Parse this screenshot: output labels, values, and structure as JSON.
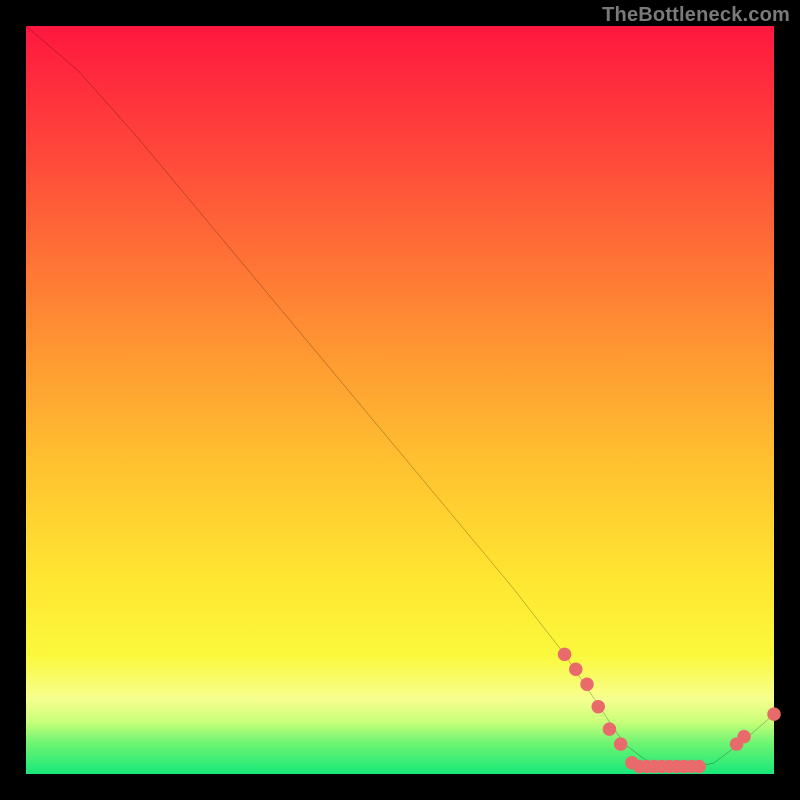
{
  "watermark": "TheBottleneck.com",
  "colors": {
    "frame": "#000000",
    "line": "#000000",
    "marker": "#e96a6a",
    "gradient_top": "#ff173f",
    "gradient_bottom": "#18e879"
  },
  "chart_data": {
    "type": "line",
    "title": "",
    "xlabel": "",
    "ylabel": "",
    "xlim": [
      0,
      100
    ],
    "ylim": [
      0,
      100
    ],
    "x": [
      0,
      7,
      15,
      25,
      35,
      45,
      55,
      65,
      72,
      76,
      80,
      84,
      88,
      92,
      96,
      100
    ],
    "y": [
      100,
      94,
      85,
      73,
      61,
      49,
      37,
      25,
      16,
      10,
      4,
      1,
      0.5,
      1.5,
      4.5,
      8
    ],
    "series": [
      {
        "name": "bottleneck-curve",
        "x": [
          0,
          7,
          15,
          25,
          35,
          45,
          55,
          65,
          72,
          76,
          80,
          84,
          88,
          92,
          96,
          100
        ],
        "y": [
          100,
          94,
          85,
          73,
          61,
          49,
          37,
          25,
          16,
          10,
          4,
          1,
          0.5,
          1.5,
          4.5,
          8
        ]
      }
    ],
    "markers": [
      {
        "x": 72,
        "y": 16
      },
      {
        "x": 73.5,
        "y": 14
      },
      {
        "x": 75,
        "y": 12
      },
      {
        "x": 76.5,
        "y": 9
      },
      {
        "x": 78,
        "y": 6
      },
      {
        "x": 79.5,
        "y": 4
      },
      {
        "x": 81,
        "y": 1.5
      },
      {
        "x": 82,
        "y": 1
      },
      {
        "x": 83,
        "y": 1
      },
      {
        "x": 84,
        "y": 1
      },
      {
        "x": 85,
        "y": 1
      },
      {
        "x": 86,
        "y": 1
      },
      {
        "x": 87,
        "y": 1
      },
      {
        "x": 88,
        "y": 1
      },
      {
        "x": 89,
        "y": 1
      },
      {
        "x": 90,
        "y": 1
      },
      {
        "x": 95,
        "y": 4
      },
      {
        "x": 96,
        "y": 5
      },
      {
        "x": 100,
        "y": 8
      }
    ]
  }
}
